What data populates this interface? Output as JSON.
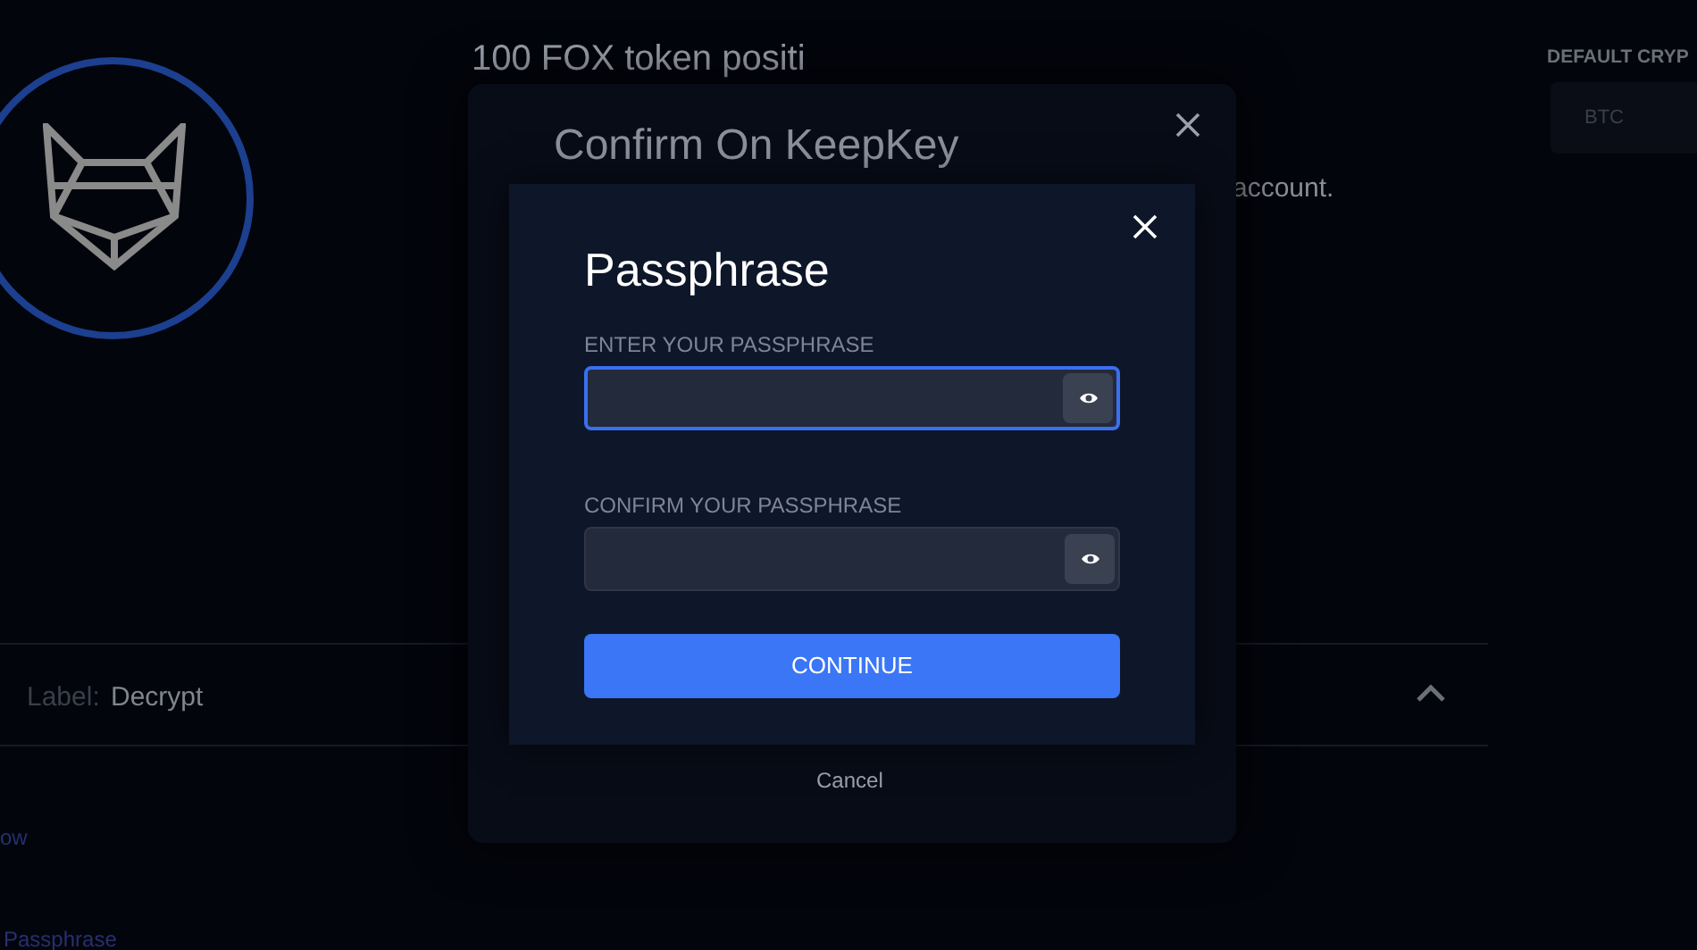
{
  "background": {
    "intro_text": "100 FOX token positi",
    "account_text": "account.",
    "label_key": "Label:",
    "label_value": "Decrypt",
    "section_expanded": true,
    "link_1": "ow",
    "link_2": "Passphrase",
    "default_crypto": {
      "label": "DEFAULT CRYP",
      "value": "BTC"
    }
  },
  "outer_dialog": {
    "title": "Confirm On KeepKey",
    "cancel": "Cancel"
  },
  "passphrase_dialog": {
    "title": "Passphrase",
    "fields": [
      {
        "label": "ENTER YOUR PASSPHRASE",
        "focused": true
      },
      {
        "label": "CONFIRM YOUR PASSPHRASE",
        "focused": false
      }
    ],
    "button": "CONTINUE"
  }
}
